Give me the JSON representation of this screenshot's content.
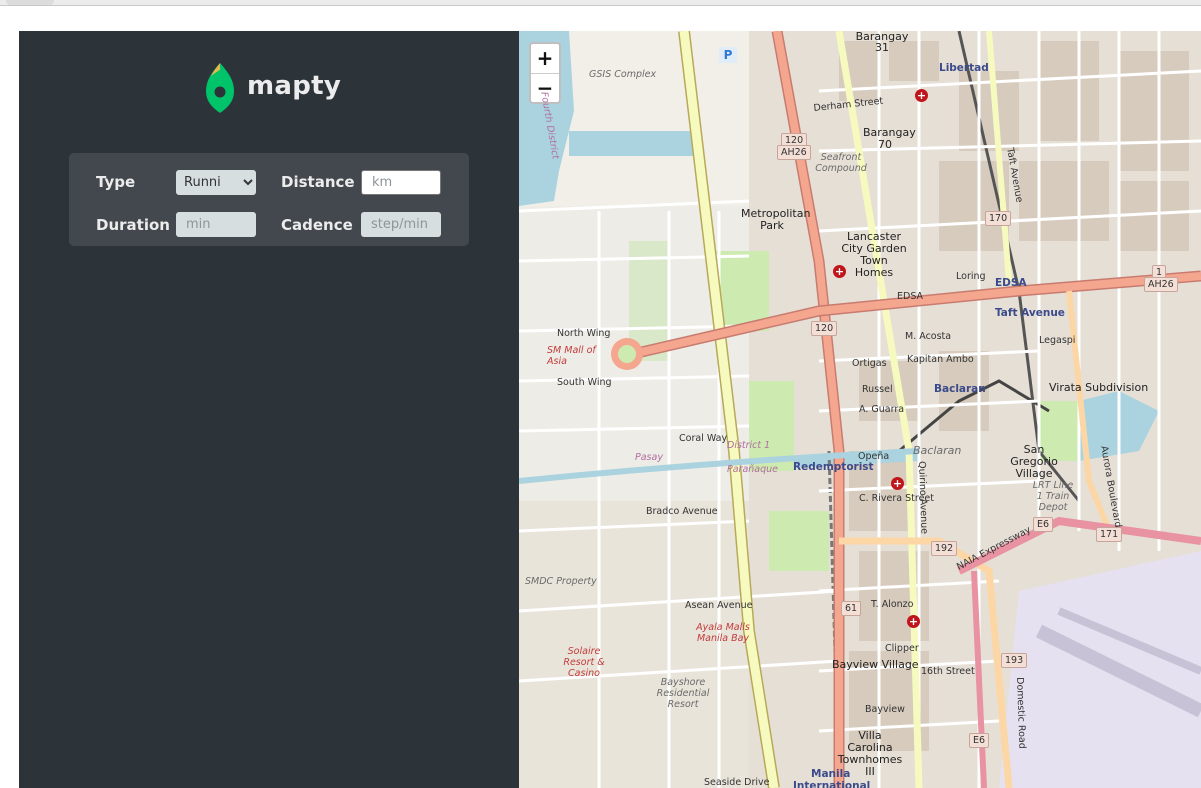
{
  "app": {
    "name": "mapty"
  },
  "form": {
    "type_label": "Type",
    "type_value": "Runni",
    "distance_label": "Distance",
    "distance_placeholder": "km",
    "duration_label": "Duration",
    "duration_placeholder": "min",
    "cadence_label": "Cadence",
    "cadence_placeholder": "step/min"
  },
  "map": {
    "zoom_in": "+",
    "zoom_out": "−",
    "places": {
      "libertad": "Libertad",
      "edsa_station": "EDSA",
      "taft_avenue": "Taft Avenue",
      "baclaran": "Baclaran",
      "redemptorist": "Redemptorist",
      "manila": "Manila",
      "international": "International"
    },
    "pois": {
      "sm_mall": "SM Mall of Asia",
      "ayala_malls": "Ayala Malls Manila Bay",
      "solaire": "Solaire Resort & Casino",
      "pasay": "Pasay",
      "paranaque": "Parañaque",
      "district1": "District 1",
      "fourth_district": "Fourth District"
    },
    "areas": {
      "gsis": "GSIS Complex",
      "seafront": "Seafront Compound",
      "metropolitan_park": "Metropolitan Park",
      "lancaster": "Lancaster City Garden Town Homes",
      "virata": "Virata Subdivision",
      "san_gregorio": "San Gregorio Village",
      "smdc": "SMDC Property",
      "bayshore": "Bayshore Residential Resort",
      "bayview": "Bayview Village",
      "villa_carolina": "Villa Carolina Townhomes III",
      "lrt_depot": "LRT Line 1 Train Depot",
      "baclaran_area": "Baclaran",
      "barangay70": "Barangay 70",
      "barangay31": "Barangay 31"
    },
    "roads": {
      "edsa": "EDSA",
      "coral_way": "Coral Way",
      "bradco": "Bradco Avenue",
      "asean": "Asean Avenue",
      "seaside": "Seaside Drive",
      "naia": "NAIA Expressway",
      "aurora": "Aurora Boulevard",
      "domestic": "Domestic Road",
      "quirino": "Quirino Avenue",
      "taft": "Taft Avenue",
      "north_wing": "North Wing",
      "south_wing": "South Wing",
      "derham": "Derham Street",
      "ortigas": "Ortigas",
      "russel": "Russel",
      "a_guarra": "A. Guarra",
      "opena": "Opeña",
      "m_acosta": "M. Acosta",
      "kapitan_ambo": "Kapitan Ambo",
      "legaspi": "Legaspi",
      "loring": "Loring",
      "t_alonzo": "T. Alonzo",
      "clipper": "Clipper",
      "sixteenth": "16th Street",
      "bayview": "Bayview",
      "c_rivera": "C. Rivera Street"
    },
    "shields": {
      "r120a": "120",
      "ah26a": "AH26",
      "r120b": "120",
      "r170": "170",
      "r1": "1",
      "ah26b": "AH26",
      "r171": "171",
      "r192": "192",
      "r61": "61",
      "r193": "193",
      "e6a": "E6",
      "e6b": "E6"
    }
  }
}
